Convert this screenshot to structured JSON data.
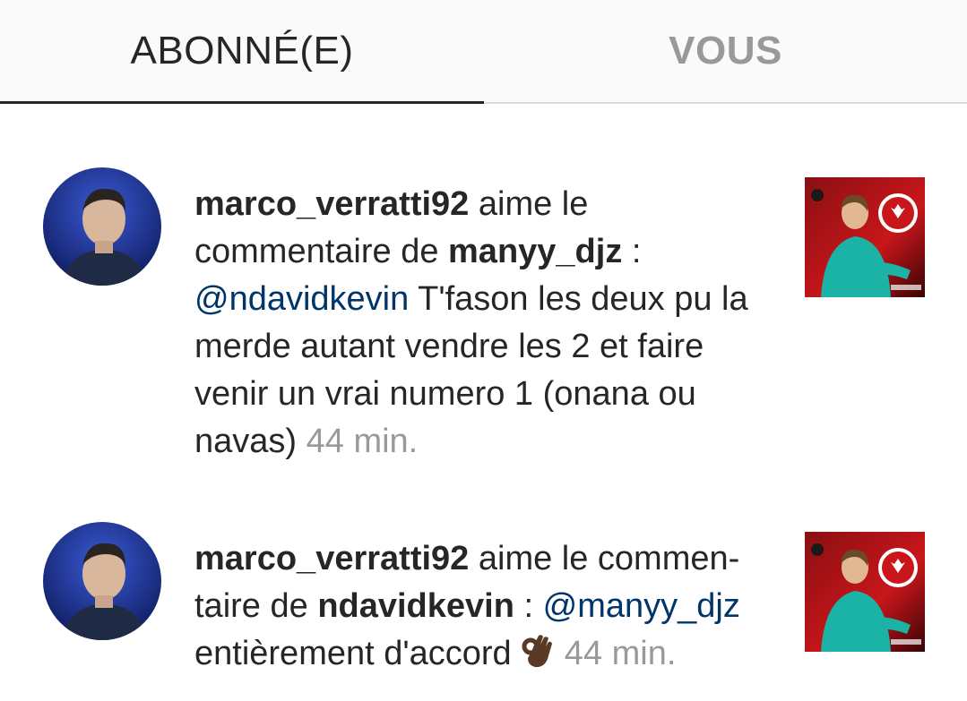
{
  "tabs": {
    "following_label": "ABONNÉ(E)",
    "you_label": "VOUS"
  },
  "activity": [
    {
      "actor": "marco_verratti92",
      "action_1": " aime le commentaire de ",
      "author": "manyy_djz",
      "separator": " : ",
      "mention": "@ndavidkevin",
      "comment": " T'fason les deux pu la merde autant vendre les 2 et faire venir un vrai numero 1 (onana ou navas)",
      "time": "44 min."
    },
    {
      "actor": "marco_verratti92",
      "action_1": " aime le commen­taire de ",
      "author": "ndavidkevin",
      "separator": " : ",
      "mention": "@manyy_djz",
      "comment": " entièrement d'accord ",
      "emoji": "ok-hand-emoji",
      "time": "44 min."
    }
  ],
  "colors": {
    "text": "#262626",
    "secondary": "#999999",
    "mention": "#003569",
    "tab_bg": "#fafafa"
  }
}
